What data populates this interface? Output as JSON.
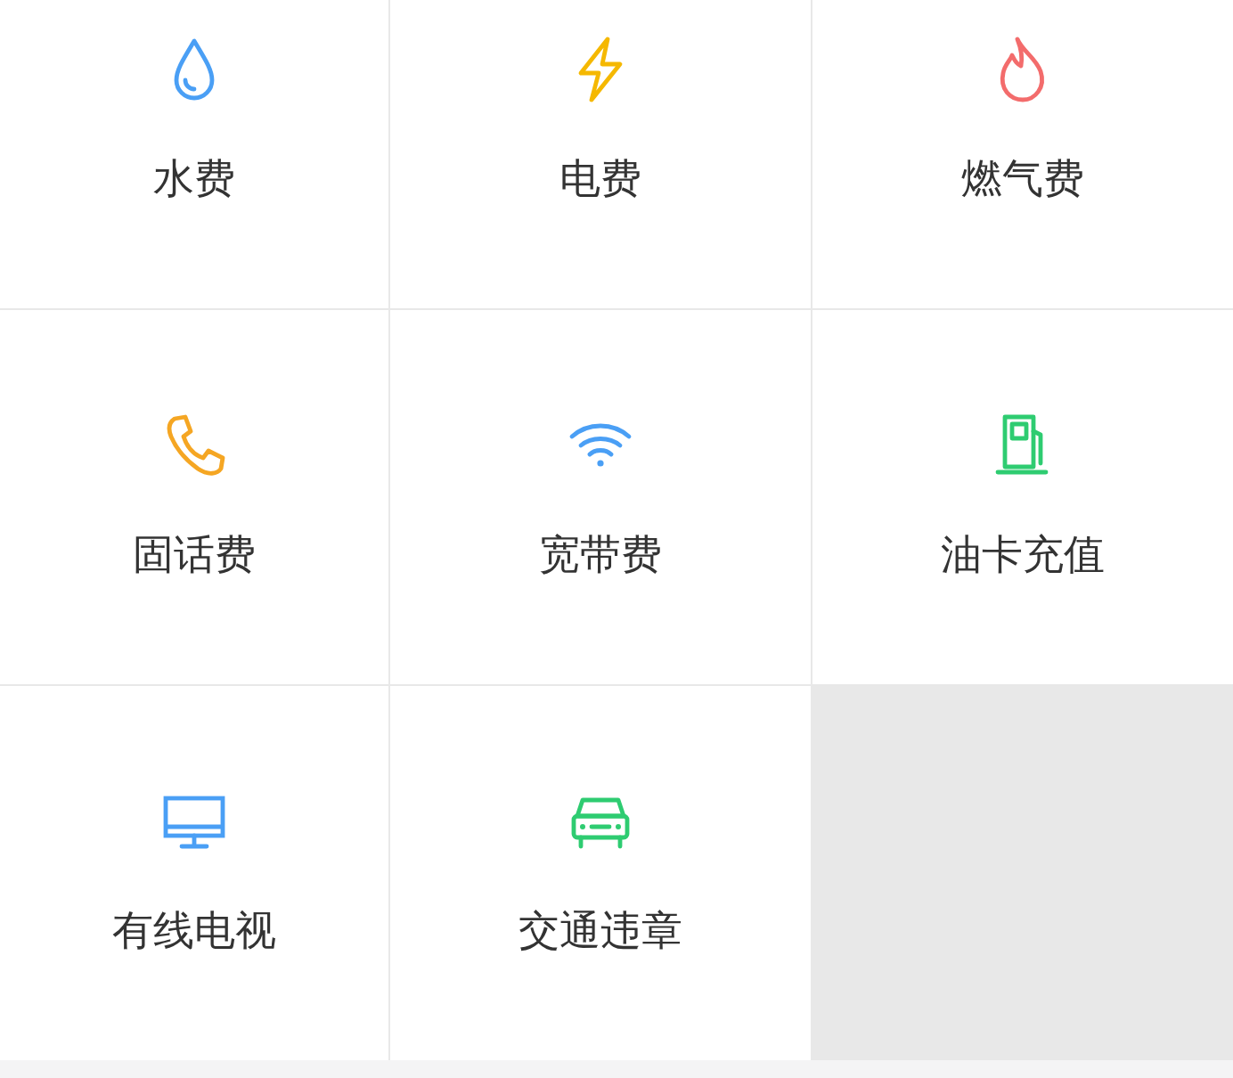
{
  "services": [
    {
      "kind": "water",
      "label": "水费"
    },
    {
      "kind": "power",
      "label": "电费"
    },
    {
      "kind": "gas",
      "label": "燃气费"
    },
    {
      "kind": "phone",
      "label": "固话费"
    },
    {
      "kind": "wifi",
      "label": "宽带费"
    },
    {
      "kind": "fuel",
      "label": "油卡充值"
    },
    {
      "kind": "tv",
      "label": "有线电视"
    },
    {
      "kind": "car",
      "label": "交通违章"
    }
  ]
}
